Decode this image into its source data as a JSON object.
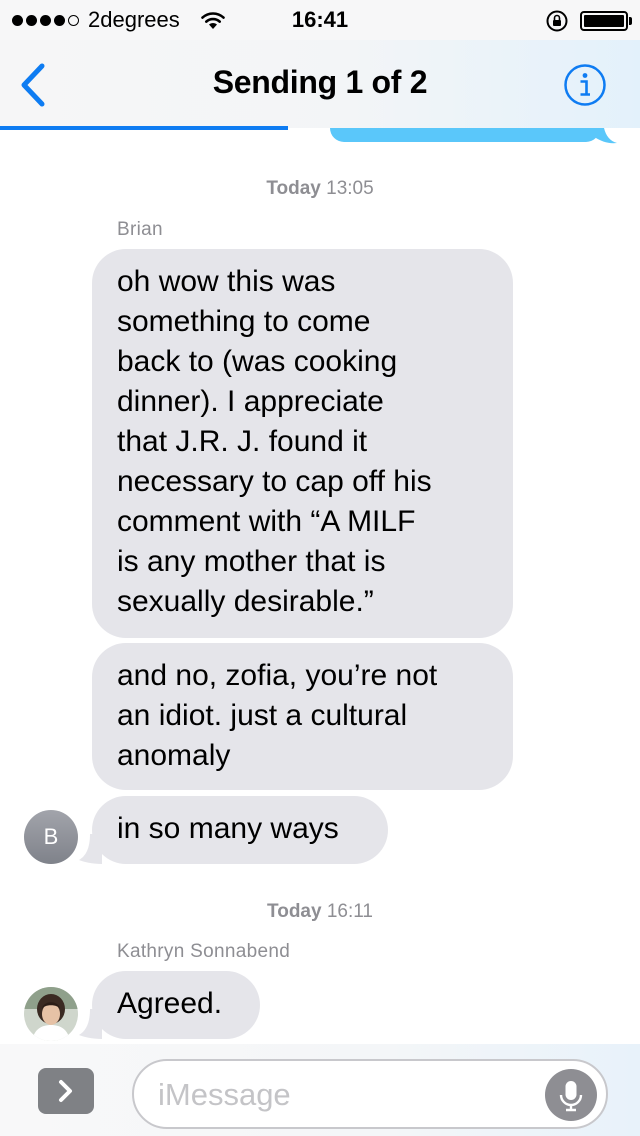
{
  "status_bar": {
    "signal_bars": 4,
    "signal_total": 5,
    "carrier": "2degrees",
    "time": "16:41",
    "battery_level": 1.0
  },
  "nav": {
    "title": "Sending 1 of 2",
    "back_icon": "chevron-left-icon",
    "info_icon": "info-icon",
    "send_progress": 0.45,
    "accent_color": "#0e7cf2"
  },
  "conversation": {
    "groups": [
      {
        "timestamp_day": "Today",
        "timestamp_time": "13:05",
        "sender": "Brian",
        "avatar_initial": "B",
        "messages": [
          {
            "lines": [
              "oh wow this was",
              "something to come",
              "back to (was cooking",
              "dinner). I appreciate",
              "that J.R. J. found it",
              "necessary to cap off his",
              "comment with “A MILF",
              "is any mother that is",
              "sexually desirable.”"
            ]
          },
          {
            "lines": [
              "and no, zofia, you’re not",
              "an idiot. just a cultural",
              "anomaly"
            ]
          },
          {
            "lines": [
              "in so many ways"
            ]
          }
        ]
      },
      {
        "timestamp_day": "Today",
        "timestamp_time": "16:11",
        "sender": "Kathryn Sonnabend",
        "messages": [
          {
            "lines": [
              "Agreed."
            ]
          }
        ]
      }
    ]
  },
  "input_bar": {
    "placeholder": "iMessage",
    "value": "",
    "expand_icon": "chevron-right-icon",
    "mic_icon": "microphone-icon"
  },
  "colors": {
    "incoming_bubble": "#e5e5ea",
    "outgoing_bubble": "#5ac7fa",
    "meta_text": "#8e8e93"
  }
}
